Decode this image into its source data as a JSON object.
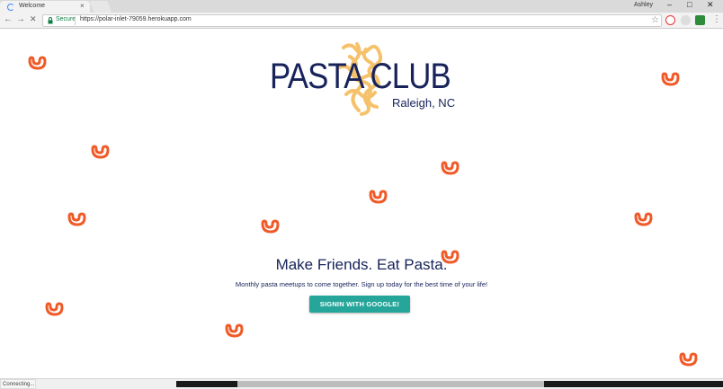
{
  "browser": {
    "tab_title": "Welcome",
    "tab_close": "×",
    "user_name": "Ashley",
    "window_minimize": "–",
    "window_maximize": "□",
    "window_close": "✕",
    "secure_label": "Secure",
    "url": "https://polar-inlet-79059.herokuapp.com",
    "back_icon": "←",
    "forward_icon": "→",
    "reload_icon": "✕",
    "star_icon": "☆",
    "menu_icon": "⋮",
    "status_text": "Connecting..."
  },
  "logo": {
    "title": "PASTA CLUB",
    "subtitle": "Raleigh, NC",
    "brand_color": "#17235a",
    "pasta_color": "#f5c26b"
  },
  "main": {
    "headline": "Make Friends. Eat Pasta.",
    "subline": "Monthly pasta meetups to come together. Sign up today for the best time of your life!",
    "signin_label": "SIGNIN WITH GOOGLE!",
    "button_color": "#26a69a",
    "pasta_icon_color": "#f05a28"
  }
}
